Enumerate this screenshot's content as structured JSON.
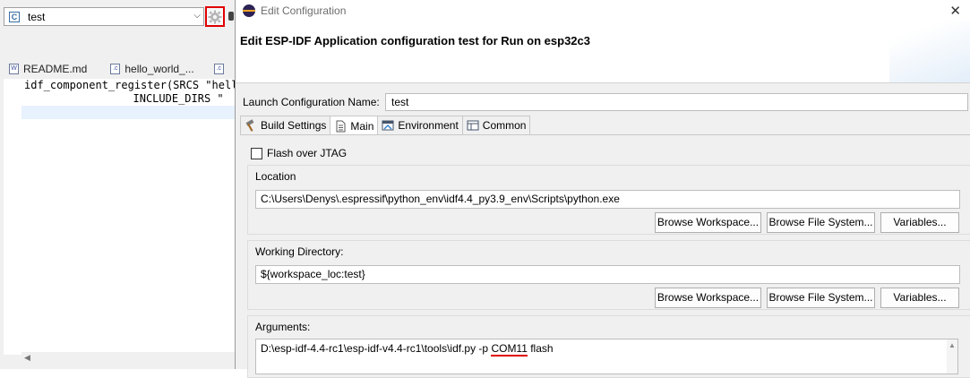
{
  "ide": {
    "launch_config_value": "test",
    "editor_tabs": [
      {
        "label": "README.md",
        "icon": "markdown-file-icon"
      },
      {
        "label": "hello_world_...",
        "icon": "c-file-icon"
      }
    ],
    "code_lines": [
      "idf_component_register(SRCS \"hello",
      "                    INCLUDE_DIRS \""
    ]
  },
  "dialog": {
    "window_title": "Edit Configuration",
    "header_title": "Edit ESP-IDF Application configuration test for Run on esp32c3",
    "name_label": "Launch Configuration Name:",
    "name_value": "test",
    "tabs": [
      {
        "label": "Build Settings",
        "icon": "hammer-icon",
        "active": false
      },
      {
        "label": "Main",
        "icon": "document-icon",
        "active": true
      },
      {
        "label": "Environment",
        "icon": "environment-icon",
        "active": false
      },
      {
        "label": "Common",
        "icon": "common-icon",
        "active": false
      }
    ],
    "flash_jtag_label": "Flash over JTAG",
    "flash_jtag_checked": false,
    "location": {
      "label": "Location",
      "value": "C:\\Users\\Denys\\.espressif\\python_env\\idf4.4_py3.9_env\\Scripts\\python.exe"
    },
    "working_directory": {
      "label": "Working Directory:",
      "value": "${workspace_loc:test}"
    },
    "arguments": {
      "label": "Arguments:",
      "prefix": "D:\\esp-idf-4.4-rc1\\esp-idf-v4.4-rc1\\tools\\idf.py -p ",
      "port": "COM11",
      "suffix": " flash"
    },
    "buttons": {
      "browse_workspace": "Browse Workspace...",
      "browse_file_system": "Browse File System...",
      "variables": "Variables..."
    }
  },
  "colors": {
    "highlight_box": "#e00000",
    "underline": "#e00000"
  }
}
